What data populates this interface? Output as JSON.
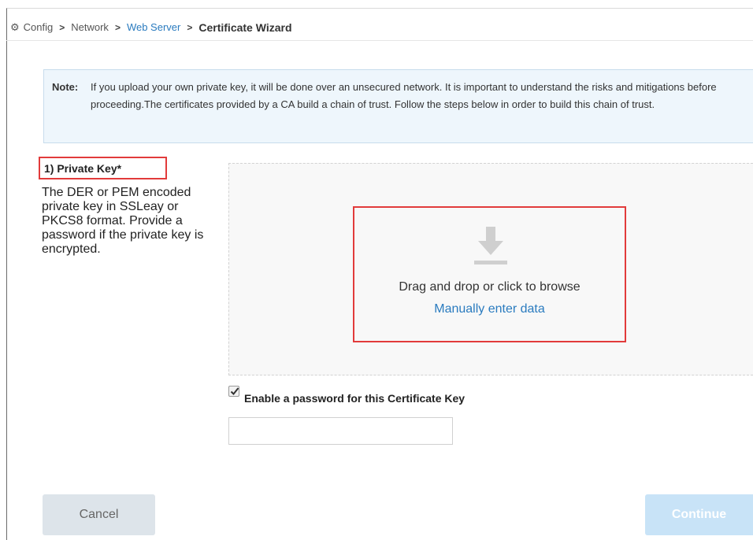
{
  "breadcrumb": {
    "items": [
      "Config",
      "Network",
      "Web Server",
      "Certificate Wizard"
    ],
    "gear_icon": "gear-icon",
    "separator": ">"
  },
  "note": {
    "label": "Note:",
    "text": "If you upload your own private key, it will be done over an unsecured network. It is important to understand the risks and mitigations before proceeding.The certificates provided by a CA build a chain of trust. Follow the steps below in order to build this chain of trust."
  },
  "step": {
    "title": "1) Private Key*",
    "description": "The DER or PEM encoded private key in SSLeay or PKCS8 format. Provide a password if the private key is encrypted."
  },
  "dropzone": {
    "icon": "download-icon",
    "text": "Drag and drop or click to browse",
    "manual_link": "Manually enter data"
  },
  "password": {
    "checked": true,
    "label": "Enable a password for this Certificate Key",
    "value": ""
  },
  "buttons": {
    "cancel": "Cancel",
    "continue": "Continue"
  },
  "colors": {
    "link": "#2a7bbf",
    "highlight": "#e23b3b",
    "note_bg": "#eef6fc",
    "continue_bg": "#c8e3f7"
  }
}
